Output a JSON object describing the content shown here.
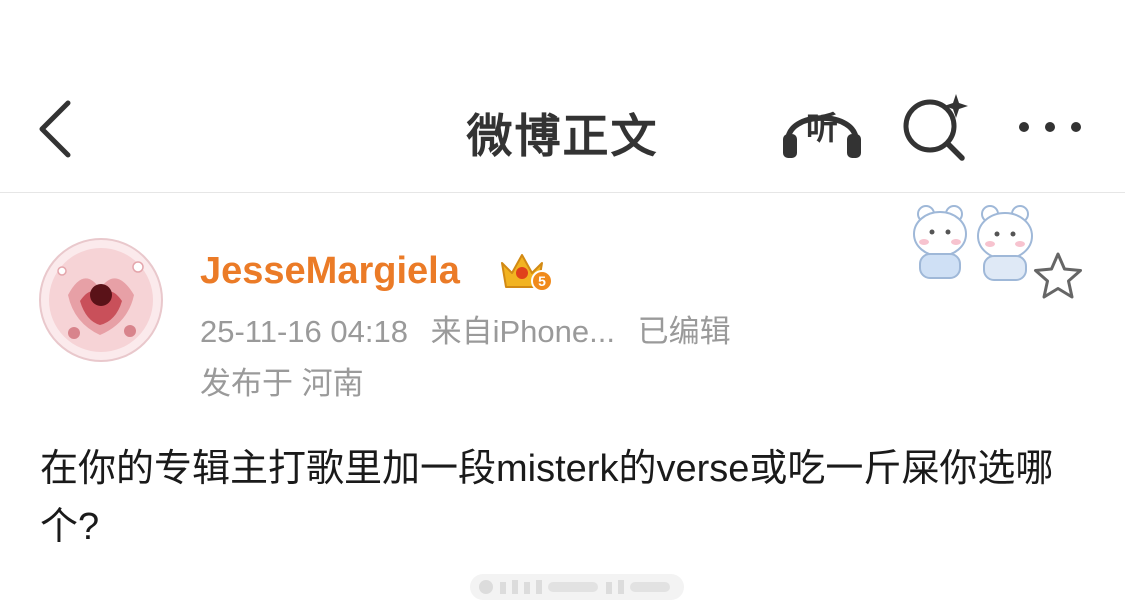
{
  "header": {
    "title": "微博正文",
    "listen_icon_label": "听",
    "icons": [
      "back-chevron-icon",
      "listen-headphones-icon",
      "search-sparkle-icon",
      "more-dots-icon"
    ]
  },
  "post": {
    "author": {
      "name": "JesseMargiela",
      "badge_text": "5"
    },
    "timestamp": "25-11-16 04:18",
    "source": "来自iPhone...",
    "edited": "已编辑",
    "location": "发布于 河南",
    "text": "在你的专辑主打歌里加一段misterk的verse或吃一斤屎你选哪个?"
  },
  "colors": {
    "username": "#eb7b27",
    "meta": "#9a9a9a",
    "title": "#333333",
    "body_text": "#1a1a1a",
    "badge_gold": "#f2b321"
  }
}
